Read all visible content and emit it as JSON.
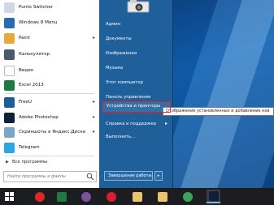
{
  "start_menu": {
    "programs": [
      {
        "label": "Punto Switcher",
        "icon": "punto-switcher-icon",
        "color": "#cfd8e3",
        "has_arrow": false
      },
      {
        "label": "Windows 8 Menu",
        "icon": "windows8-menu-icon",
        "color": "#2b6cb0",
        "has_arrow": false
      },
      {
        "label": "Paint",
        "icon": "paint-icon",
        "color": "#e7a83c",
        "has_arrow": true
      },
      {
        "label": "Калькулятор",
        "icon": "calculator-icon",
        "color": "#4a5a6a",
        "has_arrow": false
      },
      {
        "label": "Видео",
        "icon": "video-icon",
        "color": "#ffffff",
        "has_arrow": false
      },
      {
        "label": "Excel 2013",
        "icon": "excel-icon",
        "color": "#1f7a3f",
        "has_arrow": false
      },
      {
        "label": "FreeU",
        "icon": "freeu-icon",
        "color": "#1b5e9c",
        "has_arrow": true
      },
      {
        "label": "Adobe Photoshop",
        "icon": "photoshop-icon",
        "color": "#0e1f3a",
        "has_arrow": true
      },
      {
        "label": "Скриншоты в Яндекс.Диске",
        "icon": "yandex-disk-screenshot-icon",
        "color": "#7aa7c9",
        "has_arrow": true
      },
      {
        "label": "Telegram",
        "icon": "telegram-icon",
        "color": "#2ca5e0",
        "has_arrow": false
      }
    ],
    "all_programs": "Все программы",
    "search_placeholder": "Найти программы и файлы",
    "right_items": [
      {
        "label": "Админ",
        "has_arrow": false
      },
      {
        "label": "Документы",
        "has_arrow": false
      },
      {
        "label": "Изображения",
        "has_arrow": false
      },
      {
        "label": "Музыка",
        "has_arrow": false
      },
      {
        "label": "Этот компьютер",
        "has_arrow": false
      },
      {
        "label": "Панель управления",
        "has_arrow": false
      },
      {
        "label": "Устройства и принтеры",
        "has_arrow": false,
        "highlighted": true
      },
      {
        "label": "Справка и поддержка",
        "has_arrow": true
      },
      {
        "label": "Выполнить...",
        "has_arrow": false
      }
    ],
    "shutdown_label": "Завершение работы",
    "shutdown_arrow": "▸"
  },
  "tooltip": "Отображение установленных и добавление нов",
  "taskbar": {
    "items": [
      {
        "name": "start-button",
        "icon": "windows-logo-icon",
        "color": "#ffffff"
      },
      {
        "name": "yandex-browser",
        "icon": "yandex-browser-icon",
        "color": "#e32626"
      },
      {
        "name": "excel",
        "icon": "excel-icon",
        "color": "#1f7a3f"
      },
      {
        "name": "viber",
        "icon": "viber-icon",
        "color": "#7b519d"
      },
      {
        "name": "opera",
        "icon": "opera-icon",
        "color": "#d6202c"
      },
      {
        "name": "file-explorer-1",
        "icon": "folder-icon",
        "color": "#e9c46a"
      },
      {
        "name": "file-explorer-2",
        "icon": "folder-icon",
        "color": "#e9c46a"
      },
      {
        "name": "chrome",
        "icon": "chrome-icon",
        "color": "#3ba55c"
      },
      {
        "name": "photoshop",
        "icon": "photoshop-icon",
        "color": "#0e1f3a",
        "active": true
      }
    ]
  }
}
